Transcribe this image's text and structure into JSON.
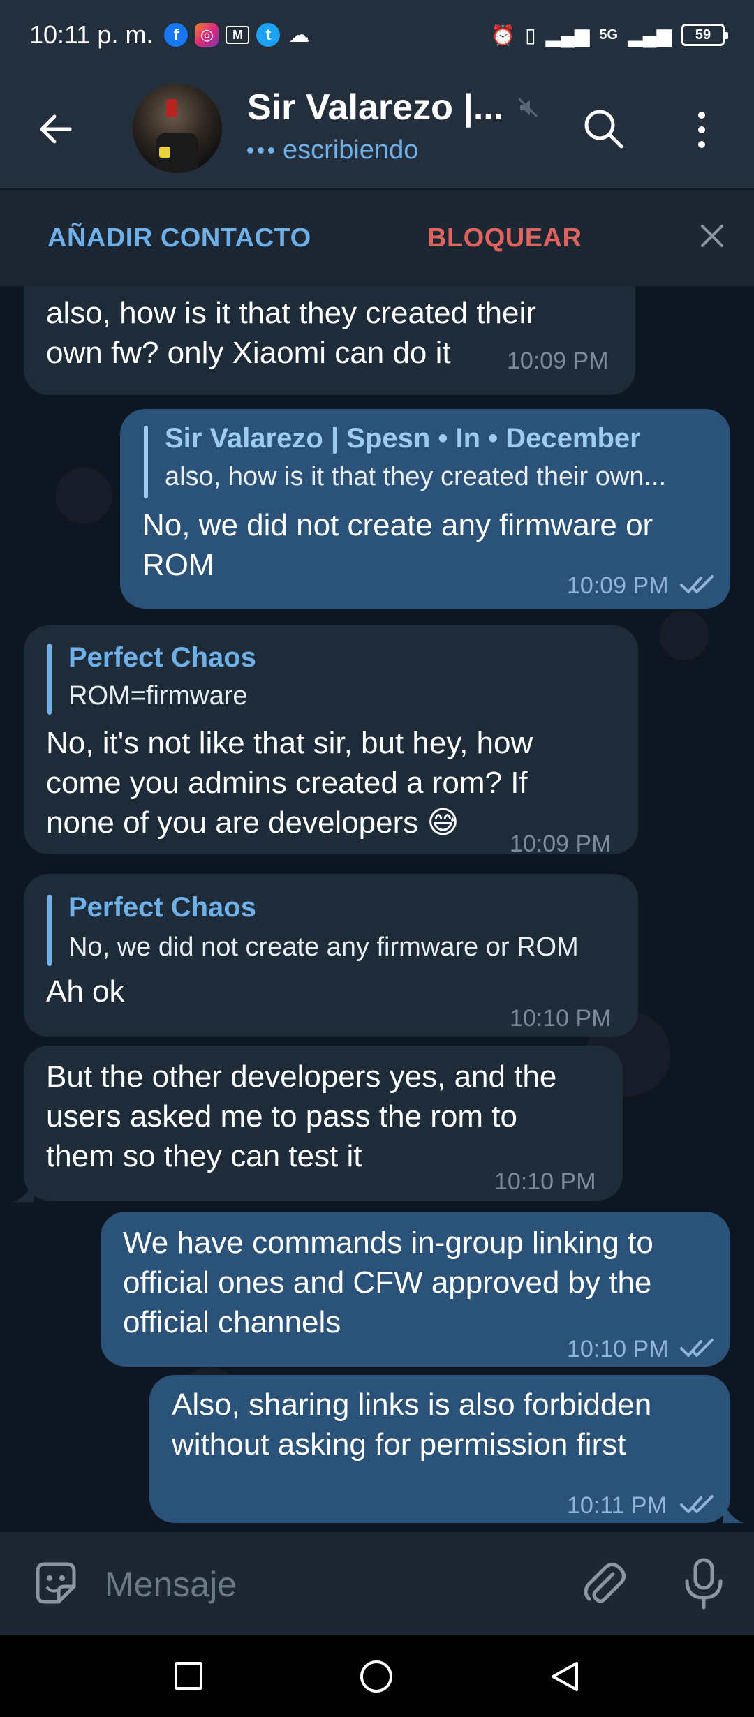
{
  "status_bar": {
    "time": "10:11 p. m.",
    "network_label": "5G",
    "battery": "59",
    "icons": [
      "facebook-icon",
      "instagram-icon",
      "gmail-icon",
      "twitter-icon",
      "cloud-icon",
      "alarm-icon",
      "vibrate-icon",
      "signal-icon",
      "battery-icon"
    ]
  },
  "header": {
    "title": "Sir Valarezo |...",
    "subtitle": "escribiendo",
    "icons": [
      "back-arrow-icon",
      "mute-icon",
      "search-icon",
      "more-vertical-icon"
    ]
  },
  "action_bar": {
    "add_contact": "AÑADIR CONTACTO",
    "block": "BLOQUEAR",
    "icons": [
      "close-icon"
    ]
  },
  "messages": [
    {
      "direction": "in",
      "text": "also, how is it that they created their\nown fw? only Xiaomi can do it",
      "time": "10:09 PM"
    },
    {
      "direction": "out",
      "reply_name": "Sir Valarezo | Spesn • In • December",
      "reply_text": "also, how is it that they created their own...",
      "text": "No, we did not create any firmware or\nROM",
      "time": "10:09 PM"
    },
    {
      "direction": "in",
      "reply_name": "Perfect Chaos",
      "reply_text": "ROM=firmware",
      "text": "No, it's not like that sir, but hey, how\ncome you admins created a rom? If\nnone of you are developers 😅",
      "time": "10:09 PM"
    },
    {
      "direction": "in",
      "reply_name": "Perfect Chaos",
      "reply_text": "No, we did not create any firmware or ROM",
      "text": "Ah ok",
      "time": "10:10 PM"
    },
    {
      "direction": "in",
      "text": "But the other developers yes, and the\nusers asked me to pass the rom to\nthem so they can test it",
      "time": "10:10 PM"
    },
    {
      "direction": "out",
      "text": "We have commands in-group linking to\nofficial ones and CFW approved by the\nofficial channels",
      "time": "10:10 PM"
    },
    {
      "direction": "out",
      "text": "Also, sharing links is also forbidden\nwithout asking for permission first",
      "time": "10:11 PM"
    }
  ],
  "input_bar": {
    "placeholder": "Mensaje",
    "icons": [
      "sticker-icon",
      "attach-icon",
      "microphone-icon"
    ]
  },
  "nav_bar": {
    "icons": [
      "recents-icon",
      "home-icon",
      "back-icon"
    ]
  },
  "colors": {
    "header_bg": "#232f3d",
    "chat_bg": "#0e1621",
    "incoming_bubble": "#1e2c3a",
    "outgoing_bubble": "#2b5278",
    "accent_blue": "#6fb0e8",
    "accent_red": "#e0635f"
  }
}
